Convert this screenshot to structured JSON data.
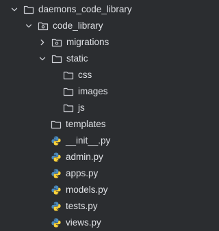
{
  "tree": {
    "root": {
      "label": "daemons_code_library",
      "expanded": true,
      "icon": "folder-icon"
    },
    "package": {
      "label": "code_library",
      "expanded": true,
      "icon": "package-folder-icon"
    },
    "migrations": {
      "label": "migrations",
      "expanded": false,
      "icon": "package-folder-icon"
    },
    "static": {
      "label": "static",
      "expanded": true,
      "icon": "folder-icon"
    },
    "css": {
      "label": "css",
      "icon": "folder-icon"
    },
    "images": {
      "label": "images",
      "icon": "folder-icon"
    },
    "js": {
      "label": "js",
      "icon": "folder-icon"
    },
    "templates": {
      "label": "templates",
      "icon": "folder-icon"
    },
    "files": [
      {
        "label": "__init__.py",
        "icon": "python-file-icon"
      },
      {
        "label": "admin.py",
        "icon": "python-file-icon"
      },
      {
        "label": "apps.py",
        "icon": "python-file-icon"
      },
      {
        "label": "models.py",
        "icon": "python-file-icon"
      },
      {
        "label": "tests.py",
        "icon": "python-file-icon"
      },
      {
        "label": "views.py",
        "icon": "python-file-icon"
      }
    ]
  },
  "colors": {
    "background": "#2b2d30",
    "text": "#dfe1e5",
    "icon_outline": "#ced0d6",
    "python_blue": "#4b8bbe",
    "python_yellow": "#ffd43b"
  }
}
